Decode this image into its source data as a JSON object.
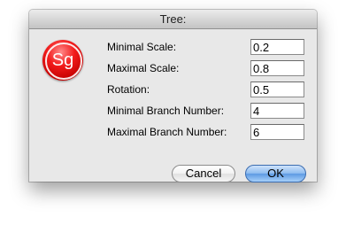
{
  "window": {
    "title": "Tree:"
  },
  "logo": {
    "text": "Sg"
  },
  "fields": [
    {
      "label": "Minimal Scale:",
      "value": "0.2"
    },
    {
      "label": "Maximal Scale:",
      "value": "0.8"
    },
    {
      "label": "Rotation:",
      "value": "0.5"
    },
    {
      "label": "Minimal Branch Number:",
      "value": "4"
    },
    {
      "label": "Maximal Branch Number:",
      "value": "6"
    }
  ],
  "buttons": {
    "cancel": "Cancel",
    "ok": "OK"
  },
  "colors": {
    "accent_button": "#5d9ae3",
    "logo_red": "#e00000"
  }
}
